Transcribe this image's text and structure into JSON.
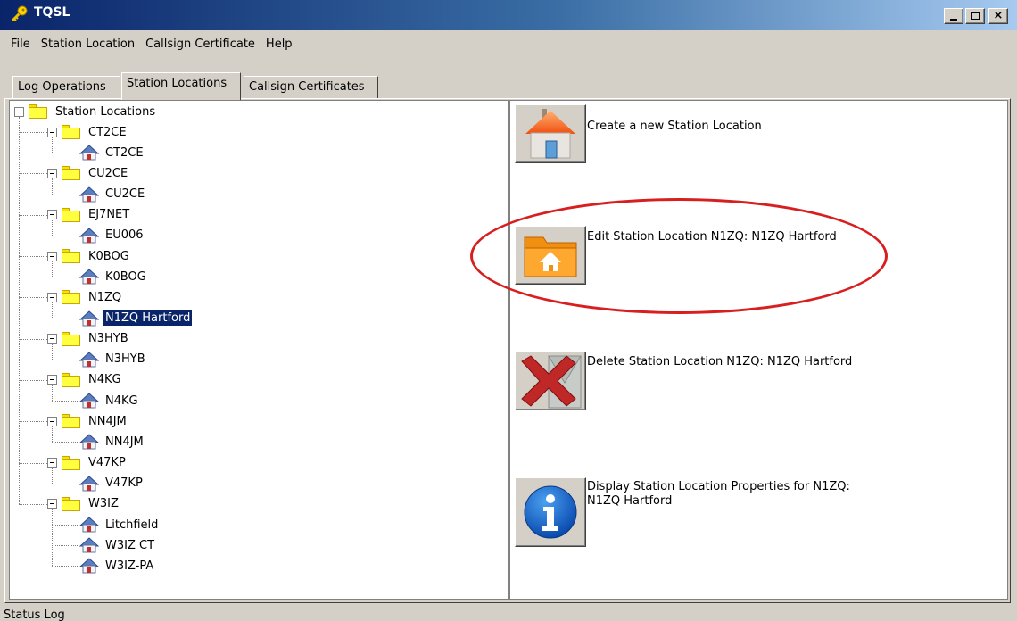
{
  "window": {
    "title": "TQSL",
    "min_glyph": "",
    "max_glyph": "",
    "close_glyph": "×"
  },
  "menu": [
    "File",
    "Station Location",
    "Callsign Certificate",
    "Help"
  ],
  "tabs": [
    "Log Operations",
    "Station Locations",
    "Callsign Certificates"
  ],
  "active_tab": "Station Locations",
  "tree": {
    "root": "Station Locations",
    "groups": [
      {
        "call": "CT2CE",
        "locations": [
          "CT2CE"
        ]
      },
      {
        "call": "CU2CE",
        "locations": [
          "CU2CE"
        ]
      },
      {
        "call": "EJ7NET",
        "locations": [
          "EU006"
        ]
      },
      {
        "call": "K0BOG",
        "locations": [
          "K0BOG"
        ]
      },
      {
        "call": "N1ZQ",
        "locations": [
          "N1ZQ Hartford"
        ]
      },
      {
        "call": "N3HYB",
        "locations": [
          "N3HYB"
        ]
      },
      {
        "call": "N4KG",
        "locations": [
          "N4KG"
        ]
      },
      {
        "call": "NN4JM",
        "locations": [
          "NN4JM"
        ]
      },
      {
        "call": "V47KP",
        "locations": [
          "V47KP"
        ]
      },
      {
        "call": "W3IZ",
        "locations": [
          "Litchfield",
          "W3IZ CT",
          "W3IZ-PA"
        ]
      }
    ],
    "selected": "N1ZQ Hartford"
  },
  "actions": {
    "create": "Create a new Station Location",
    "edit": "Edit Station Location N1ZQ: N1ZQ Hartford",
    "delete": "Delete Station Location N1ZQ: N1ZQ Hartford",
    "properties_line1": "Display Station Location Properties for N1ZQ:",
    "properties_line2": "N1ZQ Hartford"
  },
  "icons": {
    "app": "key-icon",
    "create": "new-house-icon",
    "edit": "folder-house-icon",
    "delete": "delete-x-icon",
    "properties": "info-icon",
    "folder": "folder-icon",
    "location": "house-icon"
  },
  "colors": {
    "selection": "#0a246a",
    "annotation": "#d81e1e",
    "titlebar": "#0a246a"
  },
  "status": "Status Log"
}
